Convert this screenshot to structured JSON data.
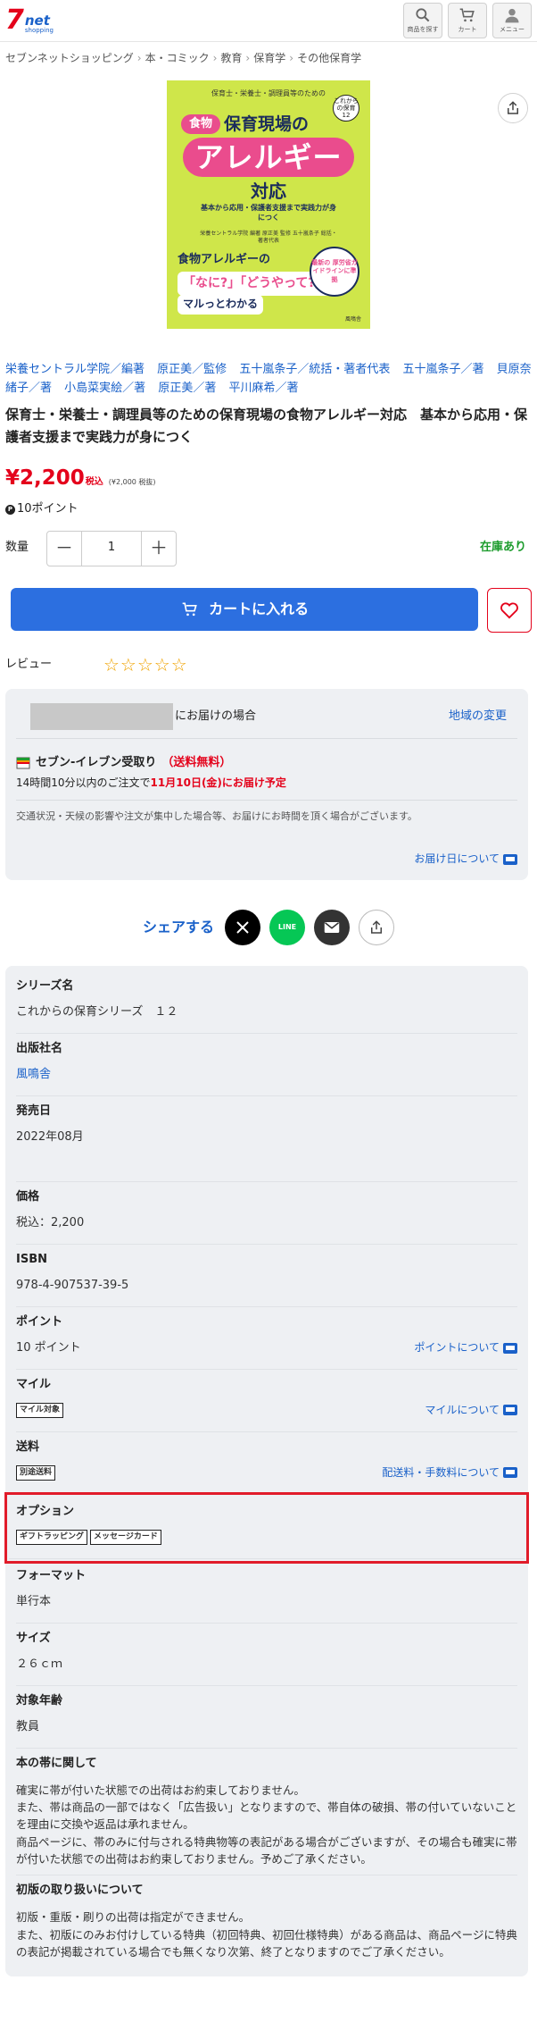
{
  "header": {
    "logo_7": "7",
    "logo_net": "net",
    "logo_shopping": "shopping",
    "search_label": "商品を探す",
    "cart_label": "カート",
    "menu_label": "メニュー"
  },
  "breadcrumb": [
    "セブンネットショッピング",
    "本・コミック",
    "教育",
    "保育学",
    "その他保育学"
  ],
  "cover": {
    "top_text": "保育士・栄養士・調理員等のための",
    "series_badge": "これからの保育 12",
    "shokumotsu": "食物",
    "title1": "保育現場の",
    "allergy": "アレルギー",
    "taiou": "対応",
    "subtitle": "基本から応用・保護者支援まで実践力が身につく",
    "authors": "栄養セントラル学院 編著 原正美 監修 五十嵐条子 総括・著者代表",
    "circle": "最新の 厚労省ガイドラインに準拠",
    "lower": "食物アレルギーの",
    "quote": "「なに?」「どうやって?」が",
    "wakaru": "マルっとわかる",
    "publisher": "風鳴舎"
  },
  "authors": [
    "栄養セントラル学院／編著",
    "原正美／監修",
    "五十嵐条子／統括・著者代表",
    "五十嵐条子／著",
    "貝原奈緒子／著",
    "小島菜実絵／著",
    "原正美／著",
    "平川麻希／著"
  ],
  "title": "保育士・栄養士・調理員等のための保育現場の食物アレルギー対応　基本から応用・保護者支援まで実践力が身につく",
  "price": {
    "amount": "¥2,200",
    "tax_label": "税込",
    "note": "(¥2,000 税抜)"
  },
  "points": {
    "icon": "P",
    "text": "10ポイント"
  },
  "quantity": {
    "label": "数量",
    "minus": "－",
    "value": "1",
    "plus": "＋",
    "stock": "在庫あり"
  },
  "cart_button": "カートに入れる",
  "review_label": "レビュー",
  "stars": "☆☆☆☆☆",
  "delivery": {
    "addr_suffix": "にお届けの場合",
    "change_link": "地域の変更",
    "store_name": "セブン‐イレブン受取り",
    "free": "（送料無料）",
    "deadline_prefix": "14時間10分以内のご注文で",
    "deadline_date": "11月10日(金)にお届け予定",
    "traffic": "交通状況・天候の影響や注文が集中した場合等、お届けにお時間を頂く場合がございます。",
    "about_link": "お届け日について"
  },
  "share": {
    "label": "シェアする",
    "line": "LINE"
  },
  "spec": {
    "series_label": "シリーズ名",
    "series_value": "これからの保育シリーズ　１２",
    "publisher_label": "出版社名",
    "publisher_value": "風鳴舎",
    "date_label": "発売日",
    "date_value": "2022年08月",
    "price_label": "価格",
    "price_value": "税込：2,200",
    "isbn_label": "ISBN",
    "isbn_value": "978-4-907537-39-5",
    "point_label": "ポイント",
    "point_value": "10 ポイント",
    "point_link": "ポイントについて",
    "mile_label": "マイル",
    "mile_tag": "マイル対象",
    "mile_link": "マイルについて",
    "ship_label": "送料",
    "ship_tag": "別途送料",
    "ship_link": "配送料・手数料について",
    "option_label": "オプション",
    "option_tag1": "ギフトラッピング",
    "option_tag2": "メッセージカード",
    "format_label": "フォーマット",
    "format_value": "単行本",
    "size_label": "サイズ",
    "size_value": "２６ｃｍ",
    "age_label": "対象年齢",
    "age_value": "教員",
    "obi_label": "本の帯に関して",
    "obi_text": "確実に帯が付いた状態での出荷はお約束しておりません。\nまた、帯は商品の一部ではなく「広告扱い」となりますので、帯自体の破損、帯の付いていないことを理由に交換や返品は承れません。\n商品ページに、帯のみに付与される特典物等の表記がある場合がございますが、その場合も確実に帯が付いた状態での出荷はお約束しておりません。予めご了承ください。",
    "first_label": "初版の取り扱いについて",
    "first_text": "初版・重版・刷りの出荷は指定ができません。\nまた、初版にのみお付けしている特典（初回特典、初回仕様特典）がある商品は、商品ページに特典の表記が掲載されている場合でも無くなり次第、終了となりますのでご了承ください。"
  }
}
